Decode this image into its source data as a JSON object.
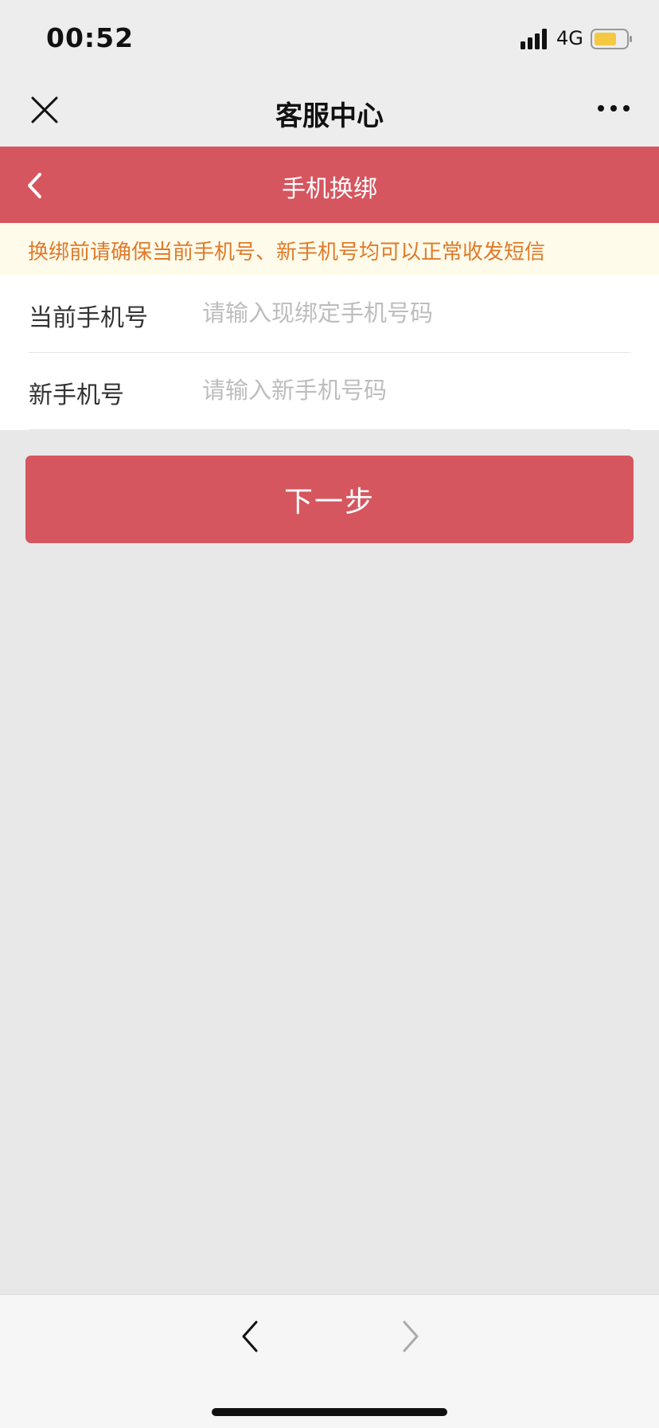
{
  "status_bar": {
    "time": "00:52",
    "network": "4G",
    "signal_icon": "signal-bars-icon",
    "battery_icon": "battery-icon",
    "battery_color": "#f5c842"
  },
  "wechat_nav": {
    "title": "客服中心",
    "close_icon": "close-icon",
    "more_icon": "more-dots-icon"
  },
  "page_header": {
    "title": "手机换绑",
    "back_icon": "chevron-left-icon",
    "background": "#d5565f"
  },
  "notice": {
    "text": "换绑前请确保当前手机号、新手机号均可以正常收发短信",
    "color": "#e07a2a"
  },
  "form": {
    "current_phone": {
      "label": "当前手机号",
      "placeholder": "请输入现绑定手机号码",
      "value": ""
    },
    "new_phone": {
      "label": "新手机号",
      "placeholder": "请输入新手机号码",
      "value": ""
    }
  },
  "next_button": {
    "label": "下一步"
  },
  "bottom_nav": {
    "back_icon": "chevron-left-icon",
    "forward_icon": "chevron-right-icon"
  }
}
